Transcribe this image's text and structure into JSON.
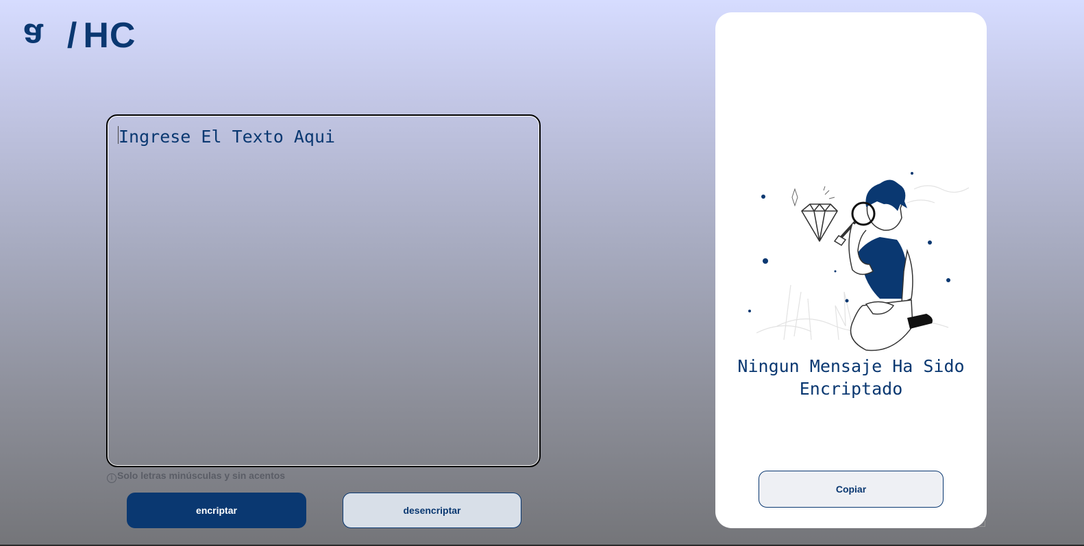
{
  "logo": {
    "mark": "a",
    "slash": "/",
    "initials": "HC"
  },
  "input": {
    "placeholder": "Ingrese El Texto Aqui",
    "value": ""
  },
  "hint": {
    "icon": "info-icon",
    "icon_glyph": "i",
    "text": "Solo letras minúsculas y sin acentos"
  },
  "buttons": {
    "encrypt_label": "encriptar",
    "decrypt_label": "desencriptar"
  },
  "output_panel": {
    "illustration": "person-with-magnifying-glass-illustration",
    "message": "Ningun Mensaje Ha Sido Encriptado",
    "copy_label": "Copiar"
  },
  "colors": {
    "primary": "#0a3871",
    "panel_bg": "#ffffff",
    "decrypt_bg": "#d8dfe8",
    "hint": "#5a5d66"
  }
}
